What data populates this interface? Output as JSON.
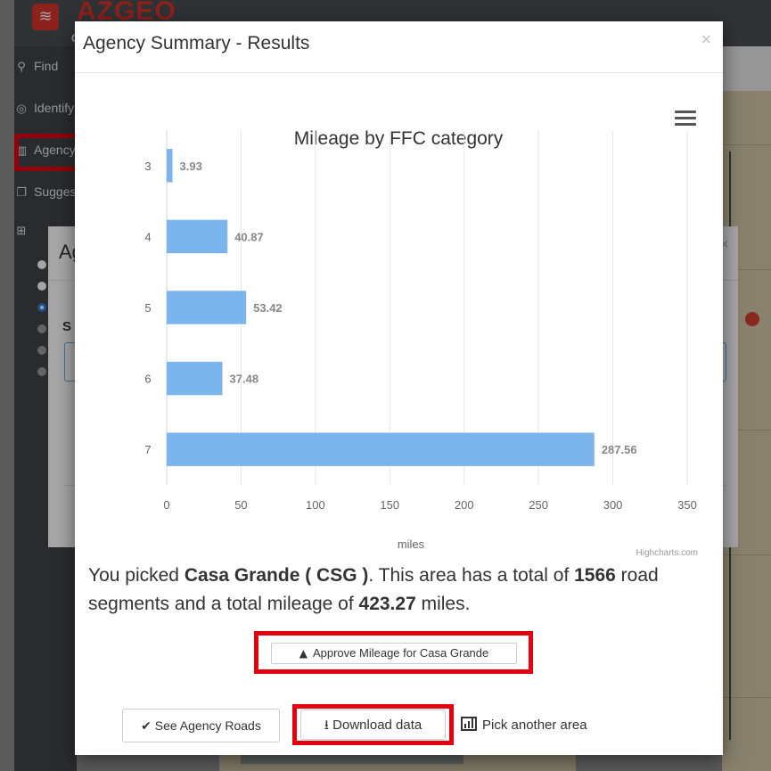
{
  "background": {
    "logo_text": "AZGEO",
    "logo_sub": "CL",
    "sidebar_items": [
      {
        "label": "Find",
        "icon": "map-pin-icon"
      },
      {
        "label": "Identify",
        "icon": "target-icon"
      },
      {
        "label": "Agency",
        "icon": "bar-chart-icon"
      },
      {
        "label": "Suggest",
        "icon": "copy-icon"
      }
    ],
    "behind_dialog": {
      "title": "Ag",
      "label": "S"
    }
  },
  "modal": {
    "title": "Agency Summary - Results",
    "close_label": "×"
  },
  "chart_data": {
    "type": "bar",
    "orientation": "horizontal",
    "title": "Mileage by FFC category",
    "categories": [
      "3",
      "4",
      "5",
      "6",
      "7"
    ],
    "values": [
      3.93,
      40.87,
      53.42,
      37.48,
      287.56
    ],
    "value_labels": [
      "3.93",
      "40.87",
      "53.42",
      "37.48",
      "287.56"
    ],
    "xlabel": "miles",
    "ylabel": "",
    "xlim": [
      0,
      350
    ],
    "x_ticks": [
      "0",
      "50",
      "100",
      "150",
      "200",
      "250",
      "300",
      "350"
    ],
    "grid": true,
    "bar_color": "#7cb5ec",
    "credits": "Highcharts.com"
  },
  "summary": {
    "prefix": "You picked ",
    "area": "Casa Grande ( CSG )",
    "mid": ". This area has a total of ",
    "segments": "1566",
    "mid2": " road segments and a total mileage of ",
    "mileage": "423.27",
    "suffix": " miles."
  },
  "buttons": {
    "approve": "Approve Mileage for Casa Grande",
    "see_roads": "See Agency Roads",
    "download": "Download data",
    "pick_area": "Pick another area"
  },
  "colors": {
    "highlight": "#e3000f",
    "bar": "#7cb5ec",
    "brand": "#d9342b"
  }
}
